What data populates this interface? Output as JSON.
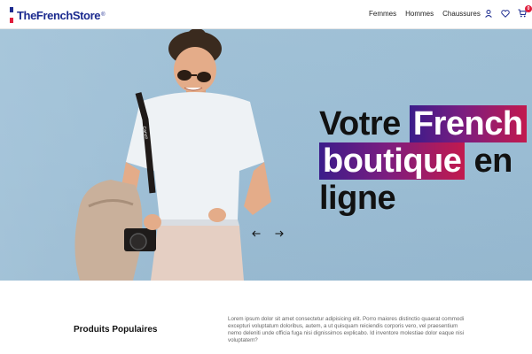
{
  "brand": {
    "name": "TheFrenchStore",
    "registered": "®",
    "flag_colors": [
      "#1c2b8f",
      "#ffffff",
      "#e01e3c"
    ]
  },
  "nav": {
    "items": [
      "Femmes",
      "Hommes",
      "Chaussures"
    ]
  },
  "header_icons": {
    "account": "user-icon",
    "wishlist": "heart-icon",
    "cart": "cart-icon",
    "cart_count": "0"
  },
  "hero": {
    "headline_line1_plain": "Votre",
    "headline_line1_highlight": "French",
    "headline_line2_highlight": "boutique",
    "headline_line2_plain": "en",
    "headline_line3_plain": "ligne",
    "prev_icon": "arrow-left-icon",
    "next_icon": "arrow-right-icon",
    "camera_strap_text": "Canon"
  },
  "popular": {
    "title": "Produits Populaires",
    "description": "Lorem ipsum dolor sit amet consectetur adipisicing elit. Porro maiores distinctio quaerat commodi excepturi voluptatum doloribus, autem, a ut quisquam reiciendis corporis vero, vel praesentium nemo deleniti unde officia fuga nisi dignissimos explicabo. Id inventore molestiae dolor eaque nisi voluptatem?"
  },
  "colors": {
    "brand_blue": "#1c2b8f",
    "accent_red": "#e01e3c",
    "highlight_start": "#3b1c8a",
    "highlight_end": "#c21a4e",
    "hero_bg": "#9ebfd6"
  }
}
